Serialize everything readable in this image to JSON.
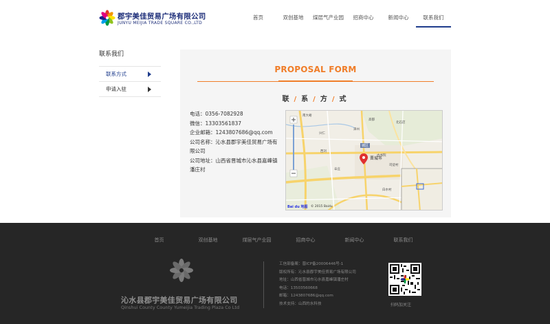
{
  "header": {
    "logo_cn": "郡宇美佳贸易广场有限公司",
    "logo_en": "JUNYU MEIJIA TRADE SQUARE CO.,LTD",
    "nav": [
      {
        "label": "首页"
      },
      {
        "label": "双创基地"
      },
      {
        "label": "煤层气产业园"
      },
      {
        "label": "招商中心"
      },
      {
        "label": "新闻中心"
      },
      {
        "label": "联系我们"
      }
    ],
    "active_index": 5
  },
  "sidebar": {
    "title": "联系我们",
    "items": [
      {
        "label": "联系方式"
      },
      {
        "label": "申请入驻"
      }
    ]
  },
  "main": {
    "proposal_title": "PROPOSAL FORM",
    "contact_heading": [
      "联",
      "系",
      "方",
      "式"
    ],
    "info": {
      "phone": "电话：0356-7082928",
      "wechat": "微信：13303561837",
      "email": "企业邮箱：1243807686@qq.com",
      "company": "公司名称：沁水县郡宇美佳贸易广场有限公司",
      "address": "公司地址：山西省晋城市沁水县嘉峰镇潘庄村"
    },
    "map": {
      "city_label": "晋城市",
      "district_label": "城区",
      "labels": [
        "南大峪",
        "兴仁",
        "西刘",
        "古书院",
        "司徒村",
        "泽州",
        "高都",
        "北石店",
        "辛庄",
        "白水村"
      ],
      "copyright": "© 2015 Baidu",
      "brand": "Bai du 地图",
      "accent_marker": "#e03030"
    }
  },
  "footer": {
    "nav": [
      {
        "label": "首页"
      },
      {
        "label": "双创基地"
      },
      {
        "label": "煤层气产业园"
      },
      {
        "label": "招商中心"
      },
      {
        "label": "新闻中心"
      },
      {
        "label": "联系我们"
      }
    ],
    "company_cn": "沁水县郡宇美佳贸易广场有限公司",
    "company_en": "Qinshui County County Yumeijia Trading Plaza Co Ltd",
    "info": [
      "工信部备案：晋ICP备20006446号-1",
      "版权所有：沁水县郡宇美佳贸易广场有限公司",
      "地址：山西省晋城市沁水县嘉峰镇潘庄村",
      "电话：13503560668",
      "邮箱：1243807686@qq.com",
      "技术支持：山西的水科技"
    ],
    "qr_label": "扫码加关注"
  },
  "colors": {
    "brand_blue": "#1e3c8c",
    "accent_orange": "#f07d28",
    "footer_bg": "#262626"
  }
}
